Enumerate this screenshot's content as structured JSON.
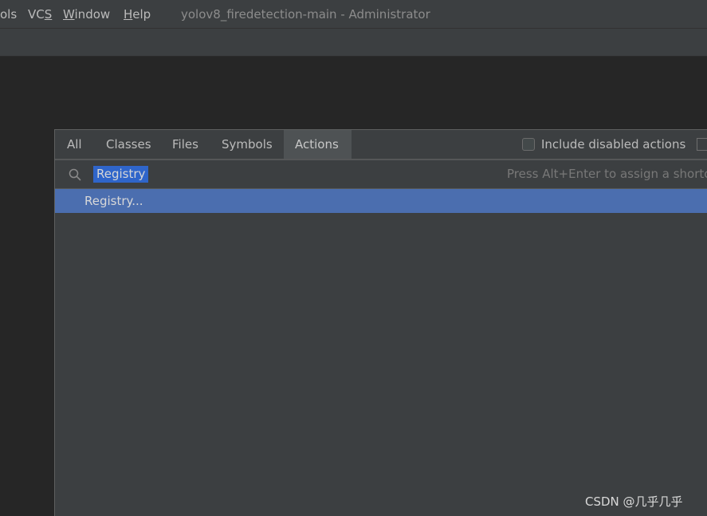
{
  "menubar": {
    "items": [
      {
        "label": "ols"
      },
      {
        "label": "VCS",
        "mnemonic": "S",
        "prefix": "VC",
        "suffix": ""
      },
      {
        "label": "Window",
        "mnemonic": "W",
        "prefix": "",
        "suffix": "indow"
      },
      {
        "label": "Help",
        "mnemonic": "H",
        "prefix": "",
        "suffix": "elp"
      }
    ],
    "window_title": "yolov8_firedetection-main - Administrator"
  },
  "search_everywhere": {
    "tabs": [
      {
        "label": "All"
      },
      {
        "label": "Classes"
      },
      {
        "label": "Files"
      },
      {
        "label": "Symbols"
      },
      {
        "label": "Actions",
        "active": true
      }
    ],
    "include_disabled_label": "Include disabled actions",
    "include_disabled_checked": false,
    "search_value": "Registry",
    "hint": "Press Alt+Enter to assign a shortcu",
    "results": [
      {
        "label": "Registry...",
        "selected": true
      }
    ]
  },
  "watermark": "CSDN @几乎几乎",
  "colors": {
    "menubar_bg": "#3c3f41",
    "popup_bg": "#3c3f41",
    "selection": "#4b6eaf",
    "text_selection": "#2f65ca",
    "editor_bg": "#262626"
  }
}
